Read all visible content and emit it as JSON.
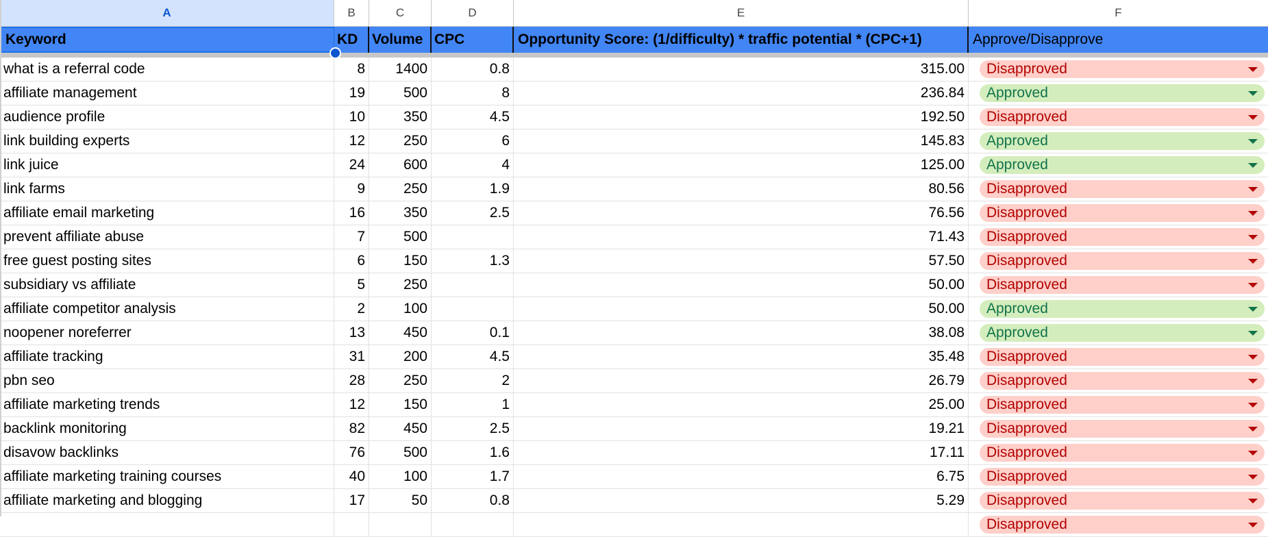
{
  "column_letters": [
    "A",
    "B",
    "C",
    "D",
    "E",
    "F"
  ],
  "selected_column": "A",
  "headers": {
    "keyword": "Keyword",
    "kd": "KD",
    "volume": "Volume",
    "cpc": "CPC",
    "score": "Opportunity Score: (1/difficulty) * traffic potential * (CPC+1)",
    "approval": "Approve/Disapprove"
  },
  "status_colors": {
    "Approved": {
      "bg": "#d4edbc",
      "fg": "#11734b"
    },
    "Disapproved": {
      "bg": "#ffcfc9",
      "fg": "#b10202"
    }
  },
  "rows": [
    {
      "keyword": "what is a referral code",
      "kd": "8",
      "volume": "1400",
      "cpc": "0.8",
      "score": "315.00",
      "status": "Disapproved"
    },
    {
      "keyword": "affiliate management",
      "kd": "19",
      "volume": "500",
      "cpc": "8",
      "score": "236.84",
      "status": "Approved"
    },
    {
      "keyword": "audience profile",
      "kd": "10",
      "volume": "350",
      "cpc": "4.5",
      "score": "192.50",
      "status": "Disapproved"
    },
    {
      "keyword": "link building experts",
      "kd": "12",
      "volume": "250",
      "cpc": "6",
      "score": "145.83",
      "status": "Approved"
    },
    {
      "keyword": "link juice",
      "kd": "24",
      "volume": "600",
      "cpc": "4",
      "score": "125.00",
      "status": "Approved"
    },
    {
      "keyword": "link farms",
      "kd": "9",
      "volume": "250",
      "cpc": "1.9",
      "score": "80.56",
      "status": "Disapproved"
    },
    {
      "keyword": "affiliate email marketing",
      "kd": "16",
      "volume": "350",
      "cpc": "2.5",
      "score": "76.56",
      "status": "Disapproved"
    },
    {
      "keyword": "prevent affiliate abuse",
      "kd": "7",
      "volume": "500",
      "cpc": "",
      "score": "71.43",
      "status": "Disapproved"
    },
    {
      "keyword": "free guest posting sites",
      "kd": "6",
      "volume": "150",
      "cpc": "1.3",
      "score": "57.50",
      "status": "Disapproved"
    },
    {
      "keyword": "subsidiary vs affiliate",
      "kd": "5",
      "volume": "250",
      "cpc": "",
      "score": "50.00",
      "status": "Disapproved"
    },
    {
      "keyword": "affiliate competitor analysis",
      "kd": "2",
      "volume": "100",
      "cpc": "",
      "score": "50.00",
      "status": "Approved"
    },
    {
      "keyword": "noopener noreferrer",
      "kd": "13",
      "volume": "450",
      "cpc": "0.1",
      "score": "38.08",
      "status": "Approved"
    },
    {
      "keyword": "affiliate tracking",
      "kd": "31",
      "volume": "200",
      "cpc": "4.5",
      "score": "35.48",
      "status": "Disapproved"
    },
    {
      "keyword": "pbn seo",
      "kd": "28",
      "volume": "250",
      "cpc": "2",
      "score": "26.79",
      "status": "Disapproved"
    },
    {
      "keyword": "affiliate marketing trends",
      "kd": "12",
      "volume": "150",
      "cpc": "1",
      "score": "25.00",
      "status": "Disapproved"
    },
    {
      "keyword": "backlink monitoring",
      "kd": "82",
      "volume": "450",
      "cpc": "2.5",
      "score": "19.21",
      "status": "Disapproved"
    },
    {
      "keyword": "disavow backlinks",
      "kd": "76",
      "volume": "500",
      "cpc": "1.6",
      "score": "17.11",
      "status": "Disapproved"
    },
    {
      "keyword": "affiliate marketing training courses",
      "kd": "40",
      "volume": "100",
      "cpc": "1.7",
      "score": "6.75",
      "status": "Disapproved"
    },
    {
      "keyword": "affiliate marketing and blogging",
      "kd": "17",
      "volume": "50",
      "cpc": "0.8",
      "score": "5.29",
      "status": "Disapproved"
    },
    {
      "keyword": "",
      "kd": "",
      "volume": "",
      "cpc": "",
      "score": "",
      "status": "Disapproved"
    }
  ]
}
